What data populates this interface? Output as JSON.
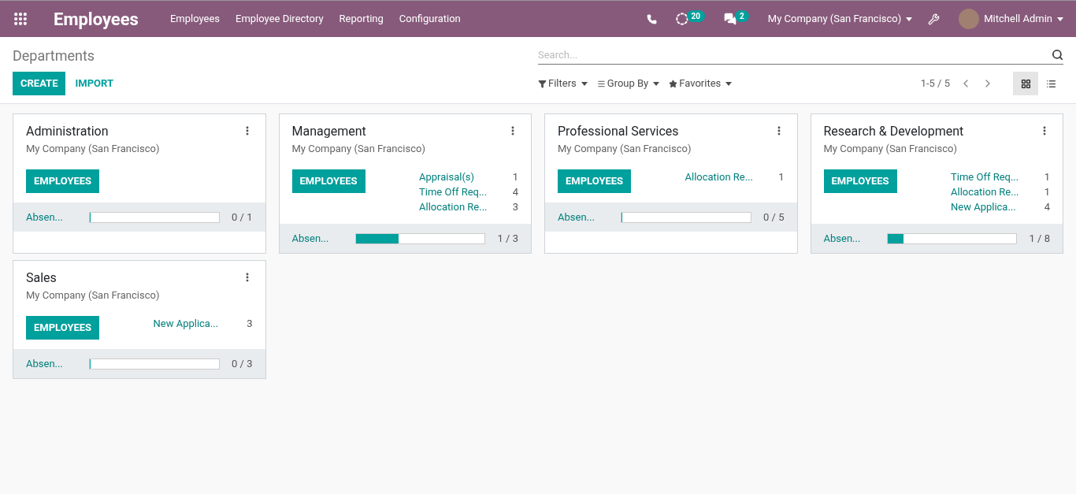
{
  "navbar": {
    "app_title": "Employees",
    "menu": [
      "Employees",
      "Employee Directory",
      "Reporting",
      "Configuration"
    ],
    "activity_count": "20",
    "message_count": "2",
    "company": "My Company (San Francisco)",
    "user": "Mitchell Admin"
  },
  "control_panel": {
    "breadcrumb": "Departments",
    "search": {
      "placeholder": "Search..."
    },
    "buttons": [
      "CREATE",
      "IMPORT"
    ],
    "filters": [
      "Filters",
      "Group By",
      "Favorites"
    ],
    "pager": "1-5 / 5",
    "views": [
      {
        "kind": "kanban",
        "selected": true
      },
      {
        "kind": "list",
        "selected": false
      }
    ]
  },
  "departments": [
    {
      "name": "Administration",
      "company": "My Company (San Francisco)",
      "button": "EMPLOYEES",
      "absence_label": "Absen...",
      "level": 0,
      "absence_count": "0 / 1"
    },
    {
      "name": "Management",
      "company": "My Company (San Francisco)",
      "button": "EMPLOYEES",
      "stats": [
        {
          "label": "Appraisal(s)",
          "count": "1"
        },
        {
          "label": "Time Off Req...",
          "count": "4"
        },
        {
          "label": "Allocation Re...",
          "count": "3"
        }
      ],
      "absence_label": "Absen...",
      "level": 0.333,
      "absence_count": "1 / 3"
    },
    {
      "name": "Professional Services",
      "company": "My Company (San Francisco)",
      "button": "EMPLOYEES",
      "stats": [
        {
          "label": "Allocation Re...",
          "count": "1"
        }
      ],
      "absence_label": "Absen...",
      "level": 0,
      "absence_count": "0 / 5"
    },
    {
      "name": "Research & Development",
      "company": "My Company (San Francisco)",
      "button": "EMPLOYEES",
      "stats": [
        {
          "label": "Time Off Req...",
          "count": "1"
        },
        {
          "label": "Allocation Re...",
          "count": "1"
        },
        {
          "label": "New Applica...",
          "count": "4"
        }
      ],
      "absence_label": "Absen...",
      "level": 0.125,
      "absence_count": "1 / 8"
    },
    {
      "name": "Sales",
      "company": "My Company (San Francisco)",
      "button": "EMPLOYEES",
      "stats": [
        {
          "label": "New Applica...",
          "count": "3"
        }
      ],
      "absence_label": "Absen...",
      "level": 0,
      "absence_count": "0 / 3"
    }
  ]
}
